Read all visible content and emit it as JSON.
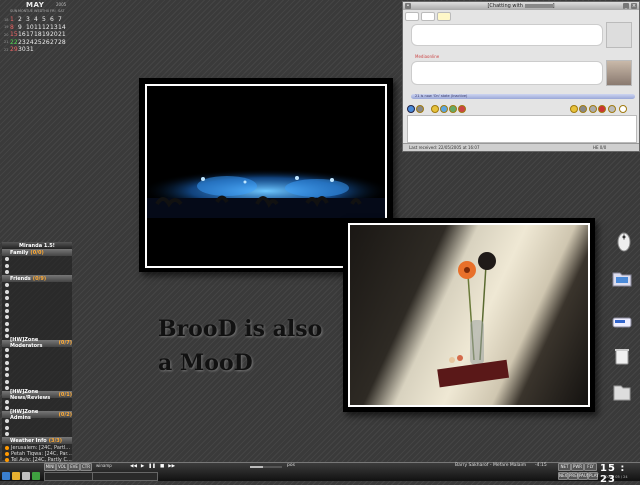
{
  "calendar": {
    "month": "MAY",
    "year": "2005",
    "dow": [
      "SUN",
      "MON",
      "TUE",
      "WED",
      "THU",
      "FRI",
      "SAT"
    ],
    "weeks": [
      {
        "no": "18",
        "days": [
          "1",
          "2",
          "3",
          "4",
          "5",
          "6",
          "7"
        ]
      },
      {
        "no": "19",
        "days": [
          "8",
          "9",
          "10",
          "11",
          "12",
          "13",
          "14"
        ]
      },
      {
        "no": "20",
        "days": [
          "15",
          "16",
          "17",
          "18",
          "19",
          "20",
          "21"
        ]
      },
      {
        "no": "21",
        "days": [
          "22",
          "23",
          "24",
          "25",
          "26",
          "27",
          "28"
        ]
      },
      {
        "no": "22",
        "days": [
          "29",
          "30",
          "31",
          "",
          "",
          "",
          ""
        ]
      }
    ],
    "today": "22"
  },
  "artwork": {
    "line1": "BrooD is also",
    "line2": "a MooD"
  },
  "miranda": {
    "title": "Miranda 1.5!",
    "groups": [
      {
        "name": "Family",
        "count": "(0/0)",
        "contacts": [
          "",
          "",
          ""
        ]
      },
      {
        "name": "Friends",
        "count": "(0/9)",
        "contacts": [
          "",
          "",
          "",
          "",
          "",
          "",
          "",
          "",
          ""
        ]
      },
      {
        "name": "[HW]Zone Moderators",
        "count": "(0/7)",
        "contacts": [
          "",
          "",
          "",
          "",
          "",
          "",
          ""
        ]
      },
      {
        "name": "[HW]Zone News/Reviews",
        "count": "(0/1)",
        "contacts": [
          "",
          ""
        ]
      },
      {
        "name": "[HW]Zone Admins",
        "count": "(0/2)",
        "contacts": [
          "",
          "",
          ""
        ]
      },
      {
        "name": "Weather Info",
        "count": "(3/3)",
        "contacts": [
          "Jerusalem: [24C, Partl...",
          "Petah Tiqwa: [24C, Par...",
          "Tel Aviv: [24C, Partly C..."
        ]
      }
    ]
  },
  "chat": {
    "title": "[Chatting with ",
    "sender": "Mediaonline",
    "status_line": "21 is now 'On' state (Inactive)",
    "last_received": "Last received: 22/05/2005 at 16:07",
    "counter": "HE 0/0"
  },
  "taskbar": {
    "top_buttons": [
      "MINI",
      "VOL",
      "EVE",
      "CTR"
    ],
    "player_text": "winamp",
    "progress_percent": 40,
    "time_text": "pos",
    "tasks": [
      "",
      ""
    ],
    "now_playing": "Barry Sakharof - Mefare Malaim",
    "track_time": "-4:15",
    "tray_buttons": [
      "NEXT",
      "PREV",
      "PAUSE",
      "PLAY"
    ],
    "tray_top_buttons": [
      "NET",
      "PWR",
      "FLY"
    ],
    "clock_time": "15 : 23",
    "clock_date": "2005 / 05 / 24"
  }
}
